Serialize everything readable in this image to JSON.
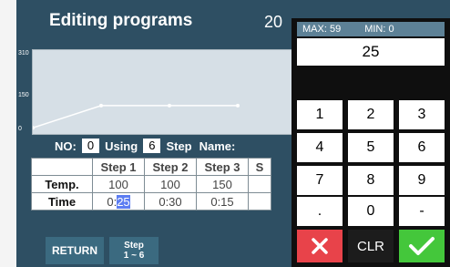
{
  "title": "Editing programs",
  "year_fragment": "20",
  "chart_data": {
    "type": "line",
    "yticks": [
      "310",
      "150",
      "0"
    ],
    "points": [
      {
        "x": 0,
        "y": 10
      },
      {
        "x": 1,
        "y": 100
      },
      {
        "x": 2,
        "y": 100
      },
      {
        "x": 3,
        "y": 100
      }
    ],
    "ylim": [
      0,
      310
    ]
  },
  "program": {
    "no_label": "NO:",
    "no_value": "0",
    "using_label": "Using",
    "using_value": "6",
    "step_label": "Step",
    "name_label": "Name:"
  },
  "table": {
    "headers": [
      "",
      "Step 1",
      "Step 2",
      "Step 3",
      "S"
    ],
    "rows": [
      {
        "label": "Temp.",
        "cells": [
          "100",
          "100",
          "150",
          ""
        ]
      },
      {
        "label": "Time",
        "cells": [
          "0:25",
          "0:30",
          "0:15",
          ""
        ]
      }
    ]
  },
  "buttons": {
    "return": "RETURN",
    "step_range_top": "Step",
    "step_range_bottom": "1 ~ 6"
  },
  "keypad": {
    "max_label": "MAX: 59",
    "min_label": "MIN: 0",
    "display_value": "25",
    "keys": [
      "1",
      "2",
      "3",
      "4",
      "5",
      "6",
      "7",
      "8",
      "9",
      ".",
      "0",
      "-"
    ],
    "clr": "CLR"
  },
  "colors": {
    "background": "#2e4f63",
    "cancel_red": "#e8434a",
    "ok_green": "#44c73b",
    "selection_blue": "#5c7df2"
  }
}
